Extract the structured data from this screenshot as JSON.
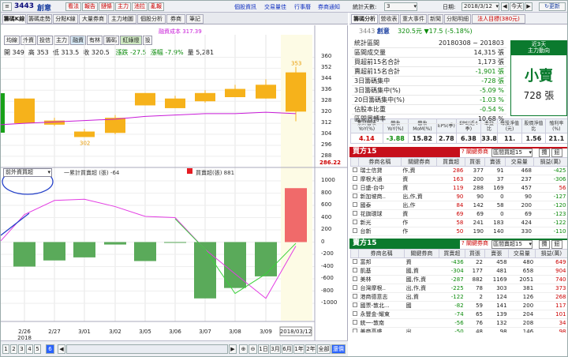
{
  "toolbar": {
    "stock_code": "3443",
    "stock_name": "創意",
    "buttons": [
      "看法",
      "報告",
      "鏈條",
      "主力",
      "池拉",
      "亂報"
    ],
    "links": [
      "個股資訊",
      "交易量佳",
      "行事曆",
      "券商通知"
    ],
    "stat_days_label": "統計天數:",
    "stat_days": "3",
    "date_label": "日期:",
    "date": "2018/3/12",
    "today": "今天",
    "refresh": "更新"
  },
  "chart_tabs": [
    "籌碼K線",
    "籌碼走勢",
    "分點K線",
    "大量券商",
    "主力地圖",
    "個股分析",
    "券商",
    "筆記"
  ],
  "sub_buttons": [
    "均線",
    "外資",
    "投信",
    "主力",
    "融資",
    "有林",
    "籌碼",
    "紅綠燈",
    "設"
  ],
  "legend_ma": "融資成本 317.39",
  "ohlc": {
    "open": "開 349",
    "high": "高 353",
    "low": "低 313.5",
    "close": "收 320.5",
    "change": "漲跌 -27.5",
    "pct": "漲幅 -7.9%",
    "vol": "量 5,281"
  },
  "price_axis": [
    "360",
    "352",
    "344",
    "336",
    "328",
    "320",
    "312",
    "304",
    "296",
    "288"
  ],
  "price_axis_min": "286.22",
  "high_tag": "353",
  "low_tag": "302",
  "chip_selector": "前外資買超",
  "chip_legend": {
    "line": "一累計買賣超 (張) -64",
    "bar": "買賣超(張) 881"
  },
  "chip_axis": [
    "1000",
    "800",
    "600",
    "400",
    "200",
    "0",
    "-200",
    "-400",
    "-600",
    "-800",
    "-1000"
  ],
  "x_dates": [
    "2/26",
    "2/27",
    "3/01",
    "3/02",
    "3/05",
    "3/06",
    "3/07",
    "3/08",
    "3/09"
  ],
  "x_year": "2018",
  "x_current": "2018/03/12",
  "chart_data": [
    {
      "type": "candlestick",
      "x": [
        "2/26",
        "2/27",
        "3/01",
        "3/02",
        "3/05",
        "3/06",
        "3/07",
        "3/08",
        "3/09",
        "3/12"
      ],
      "open": [
        330,
        314,
        306,
        316,
        334,
        330,
        334,
        337,
        340,
        349
      ],
      "close": [
        312,
        311,
        302,
        305,
        325,
        323,
        328,
        331,
        330,
        320.5
      ],
      "high": [
        330,
        316,
        308,
        318,
        334,
        332,
        336,
        340,
        344,
        353
      ],
      "low": [
        312,
        310,
        302,
        304,
        325,
        323,
        327,
        331,
        330,
        313.5
      ],
      "ylim": [
        286.22,
        362
      ]
    },
    {
      "type": "bar",
      "x": [
        "2/26",
        "2/27",
        "3/01",
        "3/02",
        "3/05",
        "3/06",
        "3/07",
        "3/08",
        "3/09",
        "3/12"
      ],
      "values": [
        -400,
        -300,
        -250,
        -40,
        -310,
        -5,
        -920,
        -750,
        -560,
        881
      ],
      "ylim": [
        -1000,
        1000
      ]
    },
    {
      "type": "line",
      "x": [
        "2/26",
        "2/27",
        "3/01",
        "3/02",
        "3/05",
        "3/06",
        "3/07",
        "3/08",
        "3/09",
        "3/12"
      ],
      "values": [
        450,
        680,
        700,
        580,
        420,
        400,
        -120,
        -520,
        -920,
        -64
      ],
      "ylim": [
        -1000,
        1000
      ]
    }
  ],
  "bottom": {
    "nav": [
      "1",
      "2",
      "3",
      "4",
      "5",
      "6"
    ],
    "zoom": [
      "1日",
      "3月",
      "6月",
      "1年",
      "2年",
      "全部"
    ],
    "mode": "還價"
  },
  "right": {
    "tabs": [
      "籌碼分析",
      "營收表",
      "重大事件",
      "新聞",
      "分點明細",
      "法人目標(380元)"
    ],
    "code": "3443",
    "name": "創意",
    "price": "320.5元",
    "change": "▼17.5 (-5.18%)",
    "stats": [
      {
        "k": "統計區間",
        "v": "20180308 ~ 201803"
      },
      {
        "k": "區間成交量",
        "v": "14,315 張"
      },
      {
        "k": "買超前15名合計",
        "v": "1,173 張"
      },
      {
        "k": "賣超前15名合計",
        "v": "-1,901 張"
      },
      {
        "k": "3日籌碼集中",
        "v": "-728 張"
      },
      {
        "k": "3日籌碼集中(%)",
        "v": "-5.09 %"
      },
      {
        "k": "20日籌碼集中(%)",
        "v": "-1.03 %"
      },
      {
        "k": "佔股本比重",
        "v": "-0.54 %"
      },
      {
        "k": "區間周轉率",
        "v": "10.68 %"
      }
    ],
    "main_force_title": "近3天",
    "main_force_sub": "主力動向",
    "main_force_status": "小賣",
    "main_force_amt": "728 張",
    "metrics_head": [
      "累計營收YoY(%)",
      "營收YoY(%)",
      "營收MoM(%)",
      "EPS(季)",
      "EPS(近4季)",
      "本益比",
      "每股淨值(元)",
      "股價淨值比",
      "殖利率(%)",
      "ROE(近4季)"
    ],
    "metrics": [
      "4.14",
      "-3.88",
      "15.82",
      "2.78",
      "6.38",
      "33.8",
      "11.",
      "1.56",
      "21.1"
    ],
    "buy_title": "買方15",
    "buy_select": "區間買超15",
    "buy_note": "? 關鍵券商",
    "cols": [
      "券商名稱",
      "關鍵券商",
      "買賣超",
      "買張",
      "賣張",
      "交易量",
      "損益(萬)"
    ],
    "buy_rows": [
      [
        "瑞士信貸",
        "作,資",
        "286",
        "377",
        "91",
        "468",
        "-425"
      ],
      [
        "摩根大通",
        "資",
        "163",
        "200",
        "37",
        "237",
        "-306"
      ],
      [
        "日盛-台中",
        "資",
        "119",
        "288",
        "169",
        "457",
        "56"
      ],
      [
        "新加坡商..",
        "出,作,資",
        "90",
        "90",
        "0",
        "90",
        "-127"
      ],
      [
        "國泰",
        "出,作",
        "84",
        "142",
        "58",
        "200",
        "-120"
      ],
      [
        "花旗環球",
        "資",
        "69",
        "69",
        "0",
        "69",
        "-123"
      ],
      [
        "新光",
        "作",
        "58",
        "241",
        "183",
        "424",
        "-122"
      ],
      [
        "台新",
        "作",
        "50",
        "190",
        "140",
        "330",
        "-110"
      ],
      [
        "群益-台南",
        "",
        "41",
        "75",
        "34",
        "109",
        "-28"
      ]
    ],
    "sell_title": "賣方15",
    "sell_select": "區間賣超15",
    "sell_rows": [
      [
        "富邦",
        "資",
        "-436",
        "22",
        "458",
        "480",
        "649"
      ],
      [
        "凱基",
        "國,資",
        "-304",
        "177",
        "481",
        "658",
        "904"
      ],
      [
        "美林",
        "國,作,資",
        "-287",
        "882",
        "1169",
        "2051",
        "740"
      ],
      [
        "台灣摩根..",
        "出,作,資",
        "-225",
        "78",
        "303",
        "381",
        "373"
      ],
      [
        "港商德意志",
        "出,資",
        "-122",
        "2",
        "124",
        "126",
        "268"
      ],
      [
        "國票-敦北...",
        "國",
        "-82",
        "59",
        "141",
        "200",
        "117"
      ],
      [
        "永豐金-耀東",
        "",
        "-74",
        "65",
        "139",
        "204",
        "101"
      ],
      [
        "統一-敦南",
        "",
        "-56",
        "76",
        "132",
        "208",
        "34"
      ],
      [
        "美商高盛",
        "出",
        "-50",
        "48",
        "98",
        "146",
        "98"
      ]
    ],
    "btn_a": "攬",
    "btn_b": "鈕"
  },
  "colors": {
    "up": "#e51c23",
    "down": "#f6b21b",
    "ma": "#c81bd8",
    "buyhdr": "#c60f1b",
    "sellhdr": "#0b7a2e"
  }
}
